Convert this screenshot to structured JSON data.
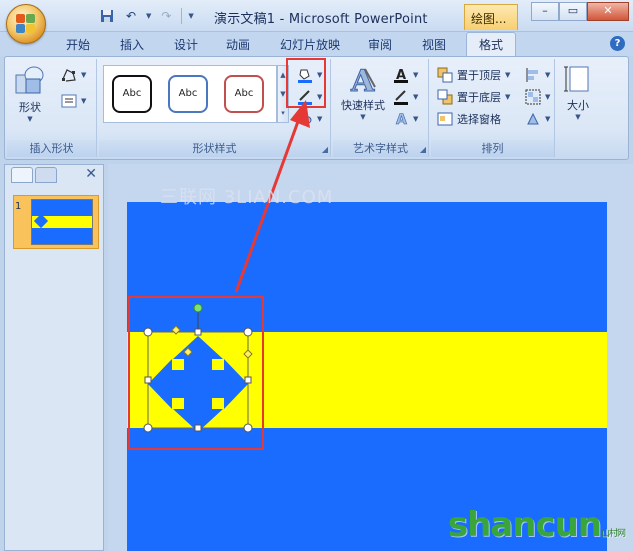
{
  "window": {
    "title": "演示文稿1 - Microsoft PowerPoint",
    "context_tab": "绘图...",
    "controls": [
      "–",
      "▭",
      "✕"
    ]
  },
  "quick_access": {
    "save_icon": "save-icon",
    "undo_icon": "undo-icon",
    "redo_icon": "redo-icon"
  },
  "tabs": [
    {
      "label": "开始"
    },
    {
      "label": "插入"
    },
    {
      "label": "设计"
    },
    {
      "label": "动画"
    },
    {
      "label": "幻灯片放映"
    },
    {
      "label": "审阅"
    },
    {
      "label": "视图"
    },
    {
      "label": "格式"
    }
  ],
  "ribbon": {
    "insert_shapes": {
      "label": "插入形状",
      "shapes_button": "形状"
    },
    "shape_styles": {
      "label": "形状样式",
      "styles": [
        "Abc",
        "Abc",
        "Abc"
      ]
    },
    "wordart_styles": {
      "label": "艺术字样式",
      "quick_styles": "快速样式"
    },
    "arrange": {
      "label": "排列",
      "bring_to_front": "置于顶层",
      "send_to_back": "置于底层",
      "selection_pane": "选择窗格"
    },
    "size": {
      "label": "大小"
    }
  },
  "slides_panel": {
    "slide_number": "1"
  },
  "watermark": "三联网 3LIAN.COM",
  "site_mark": {
    "main": "shancun",
    "sub": "山村网"
  },
  "colors": {
    "slide_blue": "#1a6cff",
    "band_yellow": "#ffff00",
    "highlight_red": "#e53935"
  }
}
